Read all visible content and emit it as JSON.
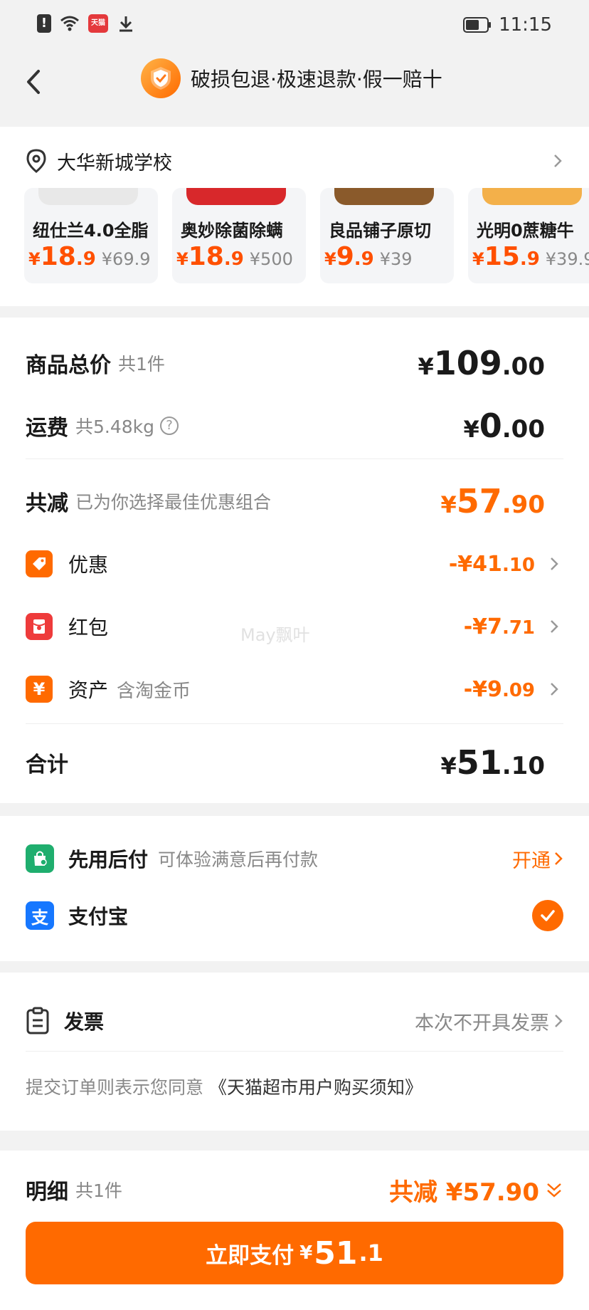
{
  "status_bar": {
    "time": "11:15",
    "tmall_badge": "天猫",
    "icons": [
      "alert-icon",
      "wifi-icon",
      "tmall-app-icon",
      "download-icon",
      "battery-icon"
    ]
  },
  "header": {
    "guarantee_text": "破损包退·极速退款·假一赔十"
  },
  "address": {
    "location": "大华新城学校"
  },
  "products": [
    {
      "name": "纽仕兰4.0全脂",
      "price_int": "18",
      "price_dec": ".9",
      "original": "¥69.9"
    },
    {
      "name": "奥妙除菌除螨",
      "price_int": "18",
      "price_dec": ".9",
      "original": "¥500"
    },
    {
      "name": "良品铺子原切",
      "price_int": "9",
      "price_dec": ".9",
      "original": "¥39"
    },
    {
      "name": "光明0蔗糖牛",
      "price_int": "15",
      "price_dec": ".9",
      "original": "¥39.9"
    }
  ],
  "summary": {
    "goods_total_label": "商品总价",
    "goods_total_count": "共1件",
    "goods_total_int": "109",
    "goods_total_dec": ".00",
    "shipping_label": "运费",
    "shipping_weight": "共5.48kg",
    "shipping_int": "0",
    "shipping_dec": ".00",
    "reduce_label": "共减",
    "reduce_note": "已为你选择最佳优惠组合",
    "reduce_int": "57",
    "reduce_dec": ".90",
    "discounts": [
      {
        "label": "优惠",
        "sub": "",
        "amount_main": "-¥41",
        "amount_dec": ".10"
      },
      {
        "label": "红包",
        "sub": "",
        "amount_main": "-¥7",
        "amount_dec": ".71"
      },
      {
        "label": "资产",
        "sub": "含淘金币",
        "amount_main": "-¥9",
        "amount_dec": ".09"
      }
    ],
    "total_label": "合计",
    "total_int": "51",
    "total_dec": ".10",
    "currency": "¥"
  },
  "payment": {
    "bnpl_label": "先用后付",
    "bnpl_sub": "可体验满意后再付款",
    "bnpl_action": "开通",
    "alipay_label": "支付宝"
  },
  "invoice": {
    "label": "发票",
    "value": "本次不开具发票",
    "terms_prefix": "提交订单则表示您同意",
    "terms_link": "《天猫超市用户购买须知》"
  },
  "watermark": "May飘叶",
  "bottom": {
    "detail_label": "明细",
    "detail_count": "共1件",
    "detail_discount": "共减 ¥57.90",
    "pay_label": "立即支付",
    "pay_int": "51",
    "pay_dec": ".1"
  },
  "colors": {
    "accent": "#ff6a00",
    "price": "#ff5000",
    "discount_icon": "#ff6a00",
    "redpacket_icon": "#ee3b3b",
    "bnpl_icon": "#1fae6e",
    "alipay_icon": "#1677ff"
  }
}
